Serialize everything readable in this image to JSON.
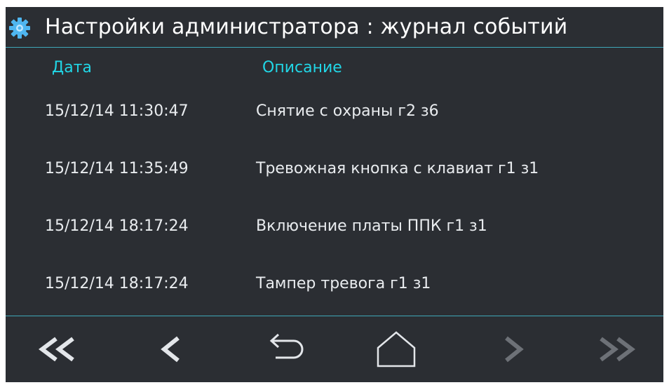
{
  "header": {
    "title": "Настройки администратора : журнал событий",
    "icon": "gear-icon"
  },
  "table": {
    "columns": [
      "Дата",
      "Описание"
    ],
    "rows": [
      {
        "date": "15/12/14 11:30:47",
        "description": "Снятие с охраны г2 з6"
      },
      {
        "date": "15/12/14 11:35:49",
        "description": "Тревожная кнопка с клавиат г1 з1"
      },
      {
        "date": "15/12/14 18:17:24",
        "description": "Включение платы ППК г1 з1"
      },
      {
        "date": "15/12/14 18:17:24",
        "description": "Тампер тревога г1 з1"
      }
    ]
  },
  "navbar": {
    "buttons": [
      {
        "icon": "double-chevron-left-icon",
        "enabled": true
      },
      {
        "icon": "chevron-left-icon",
        "enabled": true
      },
      {
        "icon": "back-arrow-icon",
        "enabled": true
      },
      {
        "icon": "home-icon",
        "enabled": true
      },
      {
        "icon": "chevron-right-icon",
        "enabled": false
      },
      {
        "icon": "double-chevron-right-icon",
        "enabled": false
      }
    ]
  },
  "colors": {
    "background": "#2b2e33",
    "accent": "#21d6e6",
    "divider": "#3fa8b8",
    "text": "#e9ecef",
    "disabled_icon": "#6d7177"
  }
}
